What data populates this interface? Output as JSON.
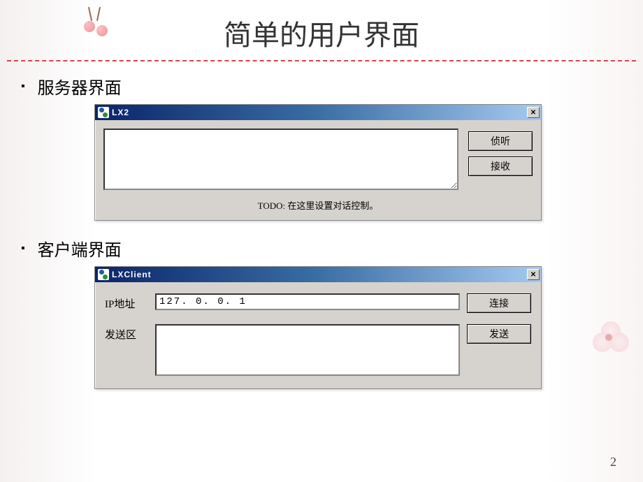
{
  "slide": {
    "title": "简单的用户界面",
    "page_number": "2"
  },
  "sections": [
    {
      "bullet": "▪",
      "label": "服务器界面"
    },
    {
      "bullet": "▪",
      "label": "客户端界面"
    }
  ],
  "server_window": {
    "title": "LX2",
    "close_glyph": "✕",
    "buttons": {
      "listen": "侦听",
      "receive": "接收"
    },
    "todo_text": "TODO: 在这里设置对话控制。",
    "textarea_value": ""
  },
  "client_window": {
    "title": "LXClient",
    "close_glyph": "✕",
    "labels": {
      "ip": "IP地址",
      "send_area": "发送区"
    },
    "ip_value": "127. 0. 0. 1",
    "send_value": "",
    "buttons": {
      "connect": "连接",
      "send": "发送"
    }
  }
}
